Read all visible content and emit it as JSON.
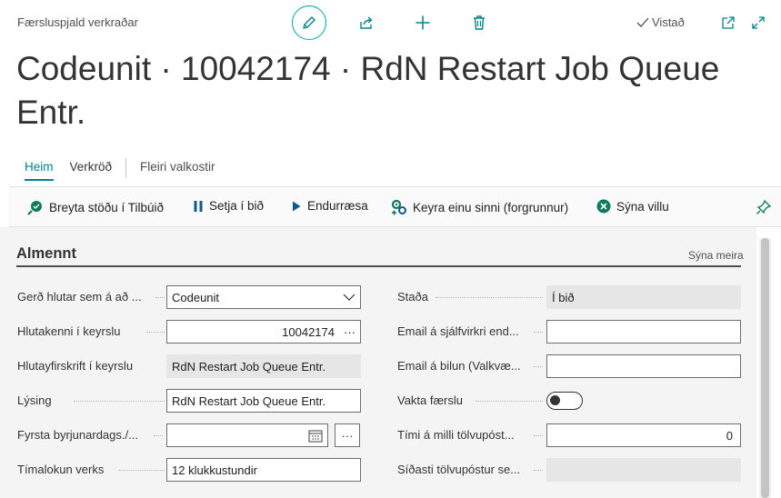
{
  "header": {
    "breadcrumb": "Færsluspjald verkraðar",
    "saved_label": "Vistað",
    "title": "Codeunit · 10042174 · RdN Restart Job Queue Entr."
  },
  "tabs": [
    {
      "label": "Heim"
    },
    {
      "label": "Verkröð"
    },
    {
      "label": "Fleiri valkostir"
    }
  ],
  "actions": [
    {
      "label": "Breyta stöðu í Tilbúið",
      "icon": "status-ready-icon"
    },
    {
      "label": "Setja í bið",
      "icon": "pause-icon"
    },
    {
      "label": "Endurræsa",
      "icon": "play-icon"
    },
    {
      "label": "Keyra einu sinni (forgrunnur)",
      "icon": "run-once-icon"
    },
    {
      "label": "Sýna villu",
      "icon": "error-icon"
    }
  ],
  "section": {
    "title": "Almennt",
    "show_more": "Sýna meira"
  },
  "left_fields": [
    {
      "label": "Gerð hlutar sem á að ...",
      "value": "Codeunit"
    },
    {
      "label": "Hlutakenni í keyrslu",
      "value": "10042174",
      "assist": "···"
    },
    {
      "label": "Hlutayfirskrift í keyrslu",
      "value": "RdN Restart Job Queue Entr."
    },
    {
      "label": "Lýsing",
      "value": "RdN Restart Job Queue Entr."
    },
    {
      "label": "Fyrsta byrjunardags./...",
      "value": "",
      "assist": "···"
    },
    {
      "label": "Tímalokun verks",
      "value": "12 klukkustundir"
    }
  ],
  "right_fields": [
    {
      "label": "Staða",
      "value": "Í bið"
    },
    {
      "label": "Email á sjálfvirkri end...",
      "value": ""
    },
    {
      "label": "Email á bilun (Valkvæ...",
      "value": ""
    },
    {
      "label": "Vakta færslu",
      "value": false
    },
    {
      "label": "Tími á milli tölvupóst...",
      "value": "0"
    },
    {
      "label": "Síðasti tölvupóstur se...",
      "value": ""
    }
  ],
  "colors": {
    "accent": "#00838a",
    "edit_ring": "#00a3a8"
  }
}
